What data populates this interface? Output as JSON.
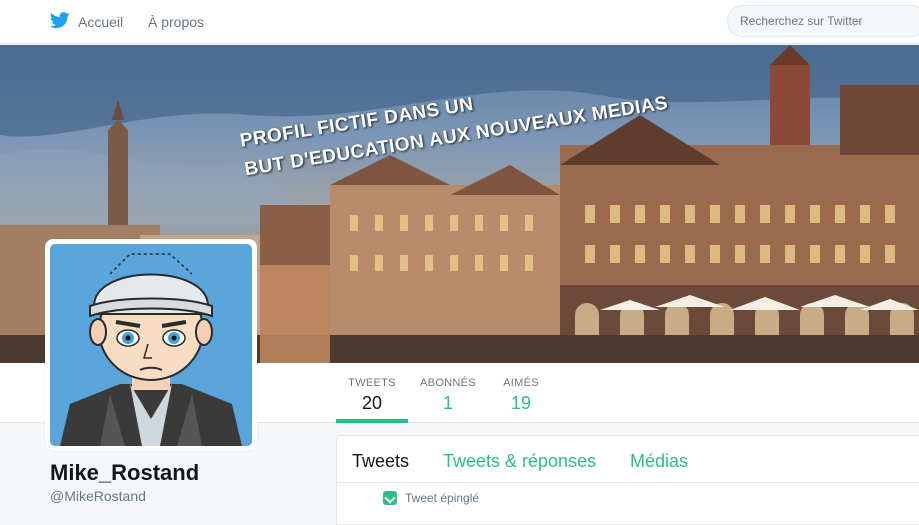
{
  "nav": {
    "home_label": "Accueil",
    "about_label": "À propos",
    "search_placeholder": "Recherchez sur Twitter"
  },
  "banner": {
    "line1": "PROFIL FICTIF DANS UN",
    "line2": "BUT D'EDUCATION AUX NOUVEAUX MEDIAS"
  },
  "stats": [
    {
      "label": "TWEETS",
      "value": "20"
    },
    {
      "label": "ABONNÉS",
      "value": "1"
    },
    {
      "label": "AIMÉS",
      "value": "19"
    }
  ],
  "profile": {
    "name": "Mike_Rostand",
    "handle": "@MikeRostand"
  },
  "timeline": {
    "tabs": [
      "Tweets",
      "Tweets & réponses",
      "Médias"
    ],
    "pinned_label": "Tweet épinglé"
  },
  "colors": {
    "accent": "#2bbf83",
    "twitter_blue": "#1da1f2",
    "avatar_bg": "#5aa6dc"
  },
  "icons": {
    "logo": "twitter-bird-icon",
    "pinned": "pin-icon"
  }
}
